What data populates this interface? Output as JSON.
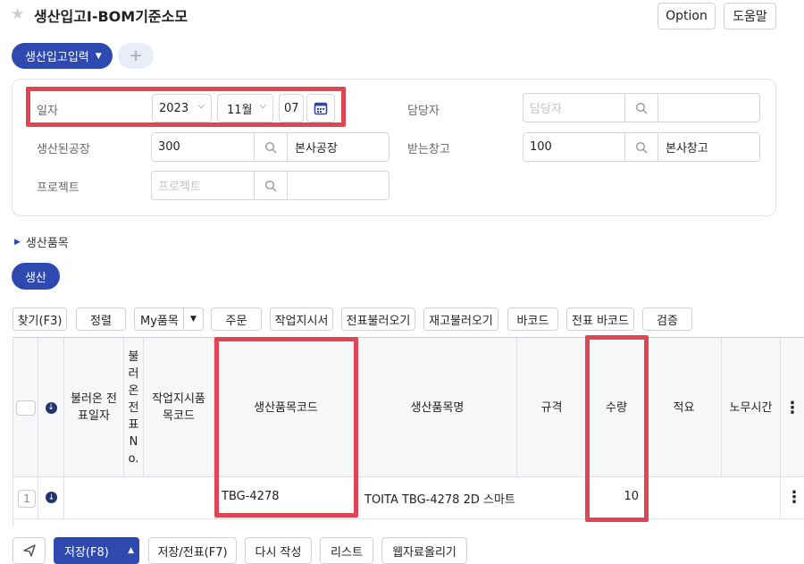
{
  "header": {
    "title": "생산입고I-BOM기준소모",
    "option_label": "Option",
    "help_label": "도움말"
  },
  "tabs": {
    "active_label": "생산입고입력",
    "add_label": "+"
  },
  "form": {
    "date_label": "일자",
    "year": "2023",
    "month": "11월",
    "day": "07",
    "manager_label": "담당자",
    "manager_placeholder": "담당자",
    "factory_label": "생산된공장",
    "factory_code": "300",
    "factory_name": "본사공장",
    "warehouse_label": "받는창고",
    "warehouse_code": "100",
    "warehouse_name": "본사창고",
    "project_label": "프로젝트",
    "project_placeholder": "프로젝트"
  },
  "section": {
    "title": "생산품목",
    "prod_button": "생산"
  },
  "toolbar": {
    "find": "찾기(F3)",
    "sort": "정렬",
    "my_items": "My품목",
    "order": "주문",
    "work_order": "작업지시서",
    "load_slip": "전표불러오기",
    "load_stock": "재고불러오기",
    "barcode": "바코드",
    "slip_barcode": "전표 바코드",
    "verify": "검증"
  },
  "table": {
    "headers": {
      "loaded_date": "불러온 전표일자",
      "loaded_no": "불러온전표No.",
      "work_item_code": "작업지시품목코드",
      "item_code": "생산품목코드",
      "item_name": "생산품목명",
      "spec": "규격",
      "qty": "수량",
      "note": "적요",
      "labor_time": "노무시간"
    },
    "rows": [
      {
        "num": "1",
        "item_code": "TBG-4278",
        "item_name": "TOITA TBG-4278 2D 스마트",
        "qty": "10"
      }
    ]
  },
  "footer": {
    "save": "저장(F8)",
    "save_slip": "저장/전표(F7)",
    "rewrite": "다시 작성",
    "list": "리스트",
    "upload": "웹자료올리기"
  },
  "colors": {
    "primary": "#2e4ab0",
    "highlight": "#e04554"
  }
}
